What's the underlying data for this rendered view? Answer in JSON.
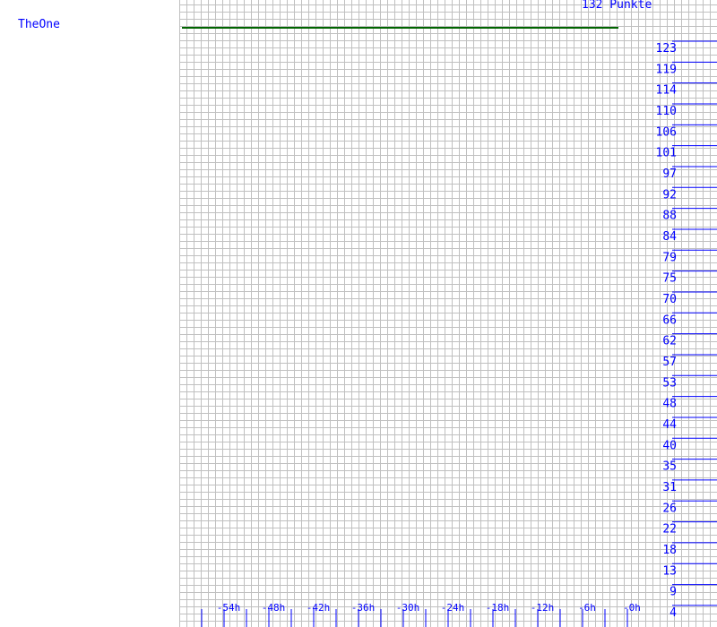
{
  "player_name": "TheOne",
  "total_label": "132 Punkte",
  "chart_data": {
    "type": "line",
    "title": "132 Punkte",
    "series": [
      {
        "name": "TheOne",
        "x": [
          "-58h",
          "-0h"
        ],
        "values": [
          132,
          132
        ],
        "color": "#006400"
      }
    ],
    "x_ticks": [
      "-54h",
      "-48h",
      "-42h",
      "-36h",
      "-30h",
      "-24h",
      "-18h",
      "-12h",
      "-6h",
      "-0h"
    ],
    "y_ticks": [
      123,
      119,
      114,
      110,
      106,
      101,
      97,
      92,
      88,
      84,
      79,
      75,
      70,
      66,
      62,
      57,
      53,
      48,
      44,
      40,
      35,
      31,
      26,
      22,
      18,
      13,
      9,
      4
    ],
    "grid": true,
    "axis_color": "#0000ff",
    "grid_color": "#c0c0c0"
  }
}
